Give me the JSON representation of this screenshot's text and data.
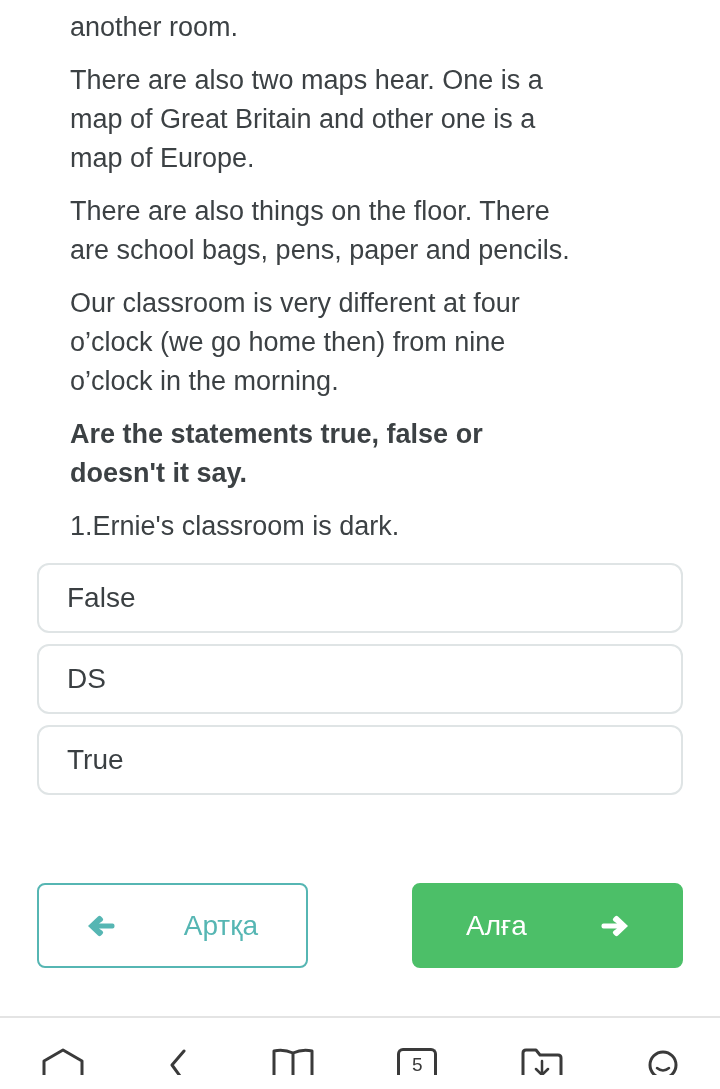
{
  "passage": {
    "paragraphs": [
      "another room.",
      "There are also two maps hear. One is a\nmap of Great Britain and other one is a\nmap of Europe.",
      "There are also things on the floor. There\nare school bags, pens, paper and pencils.",
      "Our classroom is very different at four\no’clock (we go home then) from nine\no’clock in the morning."
    ]
  },
  "question": {
    "prompt": "Are the statements true, false or\ndoesn't it say.",
    "statement": "1.Ernie's classroom is dark."
  },
  "options": [
    {
      "label": "False",
      "selected": false
    },
    {
      "label": "DS",
      "selected": false
    },
    {
      "label": "True",
      "selected": false
    }
  ],
  "navigation": {
    "back": "Артқа",
    "next": "Алға"
  },
  "bottom_bar": {
    "tab_count": "5"
  }
}
